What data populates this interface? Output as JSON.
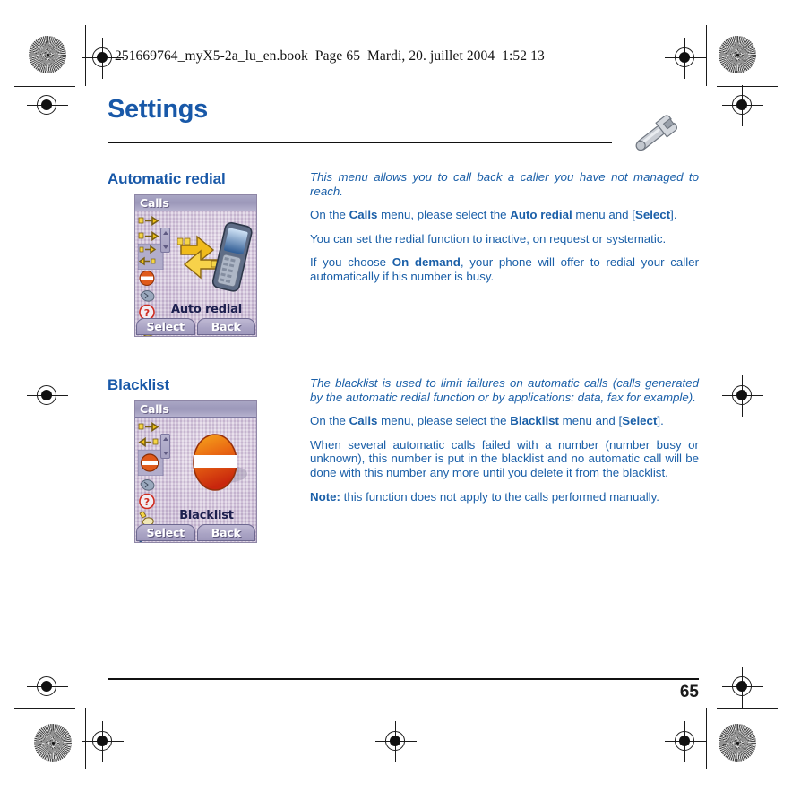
{
  "print_slug": "251669764_myX5-2a_lu_en.book  Page 65  Mardi, 20. juillet 2004  1:52 13",
  "header": {
    "title": "Settings",
    "icon": "wrench-icon"
  },
  "colors": {
    "heading_blue": "#1858a8",
    "body_blue": "#1a5fa8",
    "phone_titlebar": "#9c98ba",
    "phone_wallpaper": "#cdbfd4",
    "blacklist_sign_red": "#d4341a",
    "blacklist_sign_orange": "#f08a1e"
  },
  "sections": [
    {
      "heading": "Automatic redial",
      "screenshot": {
        "titlebar": "Calls",
        "caption": "Auto redial",
        "hero_icon": "phone-redial-arrows-icon",
        "softkeys": [
          "Select",
          "Back"
        ],
        "rail_icons": [
          "outgoing-calls-icon",
          "incoming-calls-icon",
          "call-forward-icon",
          "barring-icon",
          "call-settings-icon",
          "help-question-icon",
          "auto-redial-hand-icon"
        ]
      },
      "paragraphs": [
        {
          "style": "italic",
          "runs": [
            {
              "text": "This menu allows you to call back a caller you have not managed to reach.",
              "bold": false
            }
          ]
        },
        {
          "style": "normal",
          "runs": [
            {
              "text": "On the ",
              "bold": false
            },
            {
              "text": "Calls",
              "bold": true
            },
            {
              "text": " menu, please select the ",
              "bold": false
            },
            {
              "text": "Auto redial",
              "bold": true
            },
            {
              "text": " menu and [",
              "bold": false
            },
            {
              "text": "Select",
              "bold": true
            },
            {
              "text": "].",
              "bold": false
            }
          ]
        },
        {
          "style": "normal",
          "runs": [
            {
              "text": "You can set the redial function to inactive, on request or systematic.",
              "bold": false
            }
          ]
        },
        {
          "style": "normal",
          "runs": [
            {
              "text": "If you choose ",
              "bold": false
            },
            {
              "text": "On demand",
              "bold": true
            },
            {
              "text": ", your phone will offer to redial your caller automatically if his number is busy.",
              "bold": false
            }
          ]
        }
      ]
    },
    {
      "heading": "Blacklist",
      "screenshot": {
        "titlebar": "Calls",
        "caption": "Blacklist",
        "hero_icon": "no-entry-sign-icon",
        "softkeys": [
          "Select",
          "Back"
        ],
        "rail_icons": [
          "outgoing-calls-icon",
          "incoming-calls-icon",
          "barring-icon",
          "call-settings-icon",
          "help-question-icon",
          "auto-redial-hand-icon",
          "search-magnifier-icon"
        ]
      },
      "paragraphs": [
        {
          "style": "italic",
          "runs": [
            {
              "text": "The blacklist is used to limit failures on automatic calls (calls generated by the automatic redial function or by applications: data, fax for example).",
              "bold": false
            }
          ]
        },
        {
          "style": "normal",
          "runs": [
            {
              "text": "On the ",
              "bold": false
            },
            {
              "text": "Calls",
              "bold": true
            },
            {
              "text": " menu, please select the ",
              "bold": false
            },
            {
              "text": "Blacklist",
              "bold": true
            },
            {
              "text": " menu and [",
              "bold": false
            },
            {
              "text": "Select",
              "bold": true
            },
            {
              "text": "].",
              "bold": false
            }
          ]
        },
        {
          "style": "normal",
          "runs": [
            {
              "text": "When several automatic calls failed with a number (number busy or unknown), this number is put in the blacklist and no automatic call will be done with this number any more until you delete it from the blacklist.",
              "bold": false
            }
          ]
        },
        {
          "style": "normal",
          "runs": [
            {
              "text": "Note:",
              "bold": true
            },
            {
              "text": " this function does not apply to the calls performed manually.",
              "bold": false
            }
          ]
        }
      ]
    }
  ],
  "footer": {
    "page_number": "65"
  }
}
